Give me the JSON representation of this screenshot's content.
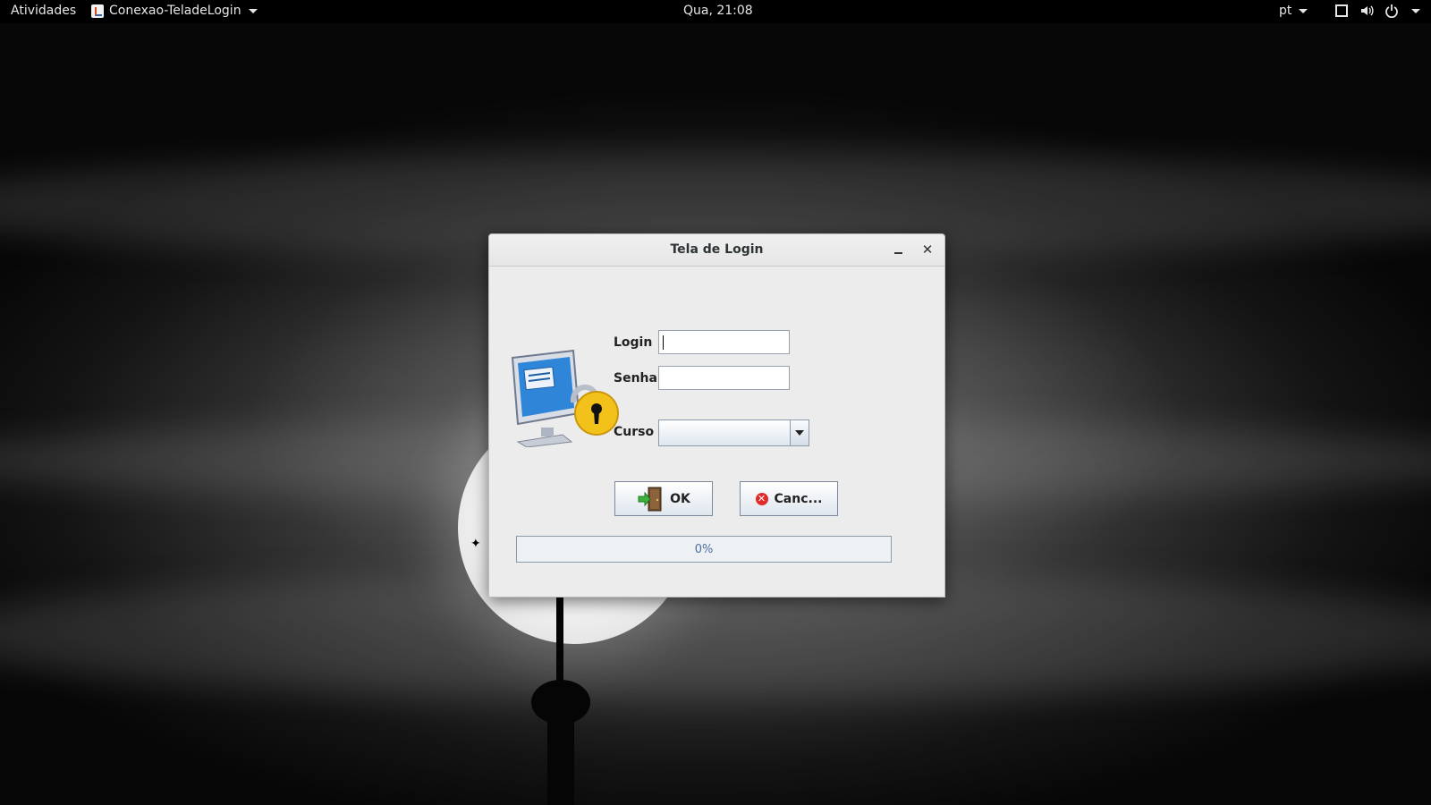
{
  "topbar": {
    "activities": "Atividades",
    "app_name": "Conexao-TeladeLogin",
    "clock": "Qua, 21:08",
    "language": "pt",
    "tray_icons": [
      "window-icon",
      "volume-icon",
      "power-icon"
    ]
  },
  "dialog": {
    "title": "Tela de Login",
    "login_label": "Login",
    "login_value": "",
    "senha_label": "Senha",
    "senha_value": "",
    "curso_label": "Curso",
    "curso_value": "",
    "ok_label": "OK",
    "cancel_label": "Canc...",
    "progress_text": "0%",
    "progress_value": 0
  },
  "colors": {
    "topbar_bg": "#000000",
    "dialog_bg": "#ececec",
    "cancel_icon": "#e12b2b",
    "progress_text": "#4a6fa0"
  }
}
